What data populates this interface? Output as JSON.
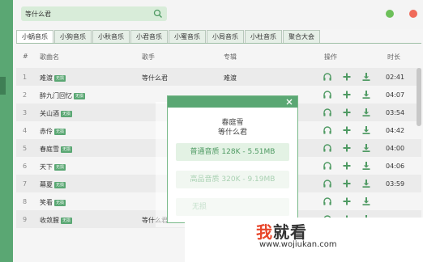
{
  "search": {
    "value": "等什么君",
    "icon": "search-icon"
  },
  "window_controls": {
    "minimize_color": "#6dc05a",
    "close_color": "#f06a5a"
  },
  "tabs": [
    {
      "label": "小蜗音乐",
      "active": true
    },
    {
      "label": "小狗音乐",
      "active": false
    },
    {
      "label": "小秋音乐",
      "active": false
    },
    {
      "label": "小君音乐",
      "active": false
    },
    {
      "label": "小蜜音乐",
      "active": false
    },
    {
      "label": "小局音乐",
      "active": false
    },
    {
      "label": "小杜音乐",
      "active": false
    },
    {
      "label": "聚合大会",
      "active": false
    }
  ],
  "table": {
    "headers": {
      "num": "#",
      "song": "歌曲名",
      "artist": "歌手",
      "album": "专辑",
      "ops": "操作",
      "duration": "时长"
    },
    "badge": "无损",
    "rows": [
      {
        "num": "1",
        "song": "难渡",
        "artist": "等什么君",
        "album": "难渡",
        "duration": "02:41"
      },
      {
        "num": "2",
        "song": "醉九门回忆",
        "artist": "",
        "album": "",
        "duration": "04:07"
      },
      {
        "num": "3",
        "song": "关山酒",
        "artist": "",
        "album": "",
        "duration": "03:54"
      },
      {
        "num": "4",
        "song": "赤伶",
        "artist": "",
        "album": "",
        "duration": "04:42"
      },
      {
        "num": "5",
        "song": "春庭雪",
        "artist": "",
        "album": "",
        "duration": "04:00"
      },
      {
        "num": "6",
        "song": "天下",
        "artist": "",
        "album": "",
        "duration": "04:06"
      },
      {
        "num": "7",
        "song": "幕夏",
        "artist": "",
        "album": "",
        "duration": "03:59"
      },
      {
        "num": "8",
        "song": "笑看",
        "artist": "",
        "album": "",
        "duration": ""
      },
      {
        "num": "9",
        "song": "收敛腥",
        "artist": "等什么君",
        "album": "",
        "duration": ""
      }
    ]
  },
  "modal": {
    "title": "春庭雪",
    "artist": "等什么君",
    "options": {
      "normal": "普通音质 128K - 5.51MB",
      "hq": "高品音质 320K - 9.19MB",
      "lossless": "无损"
    }
  },
  "watermark": {
    "brand_first": "我",
    "brand_rest": "就看",
    "url": "www.wojiukan.com"
  },
  "colors": {
    "accent": "#5aa773",
    "icon_green": "#4f9a63"
  }
}
